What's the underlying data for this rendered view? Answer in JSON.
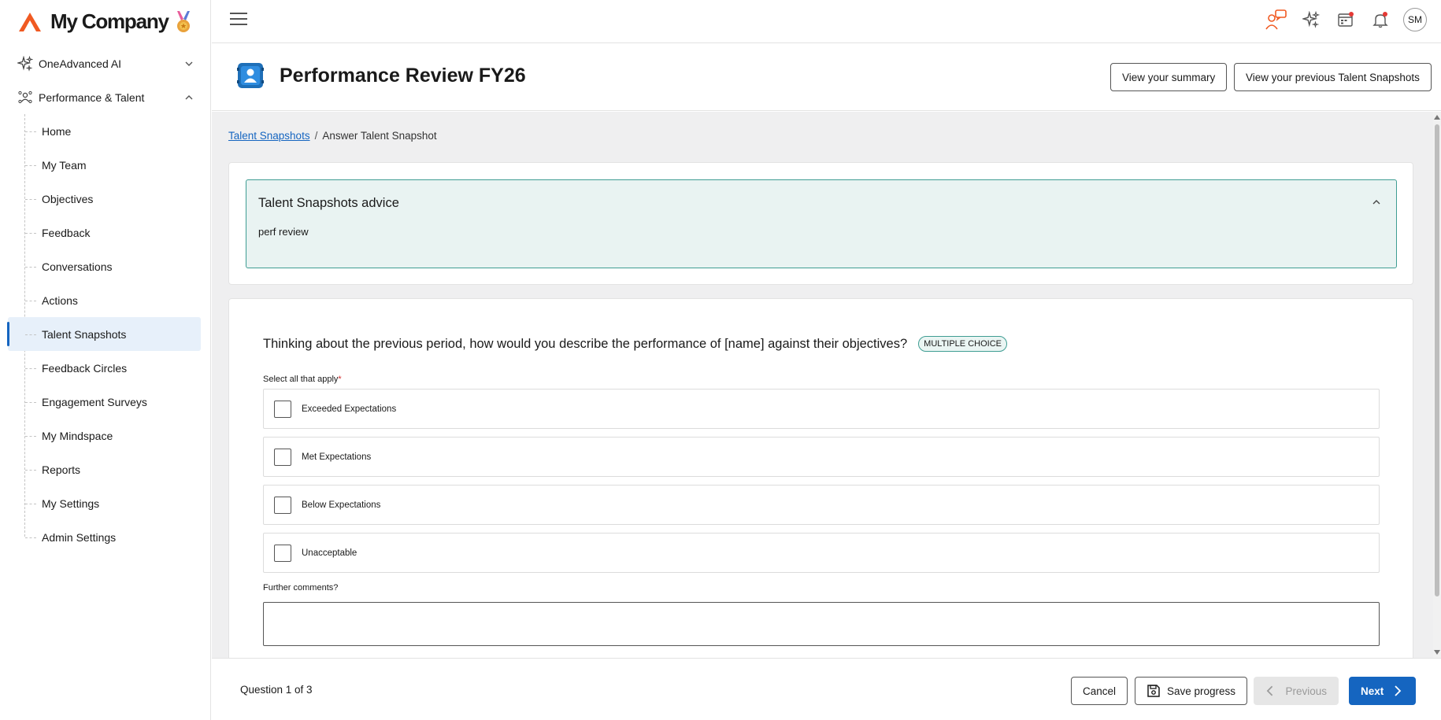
{
  "brand": {
    "name": "My Company"
  },
  "sidebar": {
    "groups": [
      {
        "label": "OneAdvanced AI",
        "icon": "sparkles-icon"
      },
      {
        "label": "Performance & Talent",
        "icon": "people-network-icon"
      }
    ],
    "items": [
      {
        "label": "Home"
      },
      {
        "label": "My Team"
      },
      {
        "label": "Objectives"
      },
      {
        "label": "Feedback"
      },
      {
        "label": "Conversations"
      },
      {
        "label": "Actions"
      },
      {
        "label": "Talent Snapshots",
        "active": true
      },
      {
        "label": "Feedback Circles"
      },
      {
        "label": "Engagement Surveys"
      },
      {
        "label": "My Mindspace"
      },
      {
        "label": "Reports"
      },
      {
        "label": "My Settings"
      },
      {
        "label": "Admin Settings"
      }
    ]
  },
  "topbar": {
    "avatar_initials": "SM",
    "icons": [
      "chat-bubbles-icon",
      "sparkles-icon",
      "calendar-icon",
      "bell-icon"
    ]
  },
  "header": {
    "title": "Performance Review FY26",
    "btn_summary": "View your summary",
    "btn_previous_snapshots": "View your previous Talent Snapshots"
  },
  "breadcrumb": {
    "link": "Talent Snapshots",
    "separator": "/",
    "current": "Answer Talent Snapshot"
  },
  "advice": {
    "title": "Talent Snapshots advice",
    "body": "perf review"
  },
  "question": {
    "text": "Thinking about the previous period, how would you describe the performance of [name] against their objectives?",
    "badge": "MULTIPLE CHOICE",
    "hint": "Select all that apply",
    "required_mark": "*",
    "options": [
      "Exceeded Expectations",
      "Met Expectations",
      "Below Expectations",
      "Unacceptable"
    ],
    "comments_label": "Further comments?",
    "comments_value": ""
  },
  "footer": {
    "progress": "Question 1 of 3",
    "cancel": "Cancel",
    "save": "Save progress",
    "previous": "Previous",
    "next": "Next"
  },
  "colors": {
    "primary": "#1565c0",
    "accent_teal": "#3f9d93",
    "brand_orange": "#f05a22"
  }
}
